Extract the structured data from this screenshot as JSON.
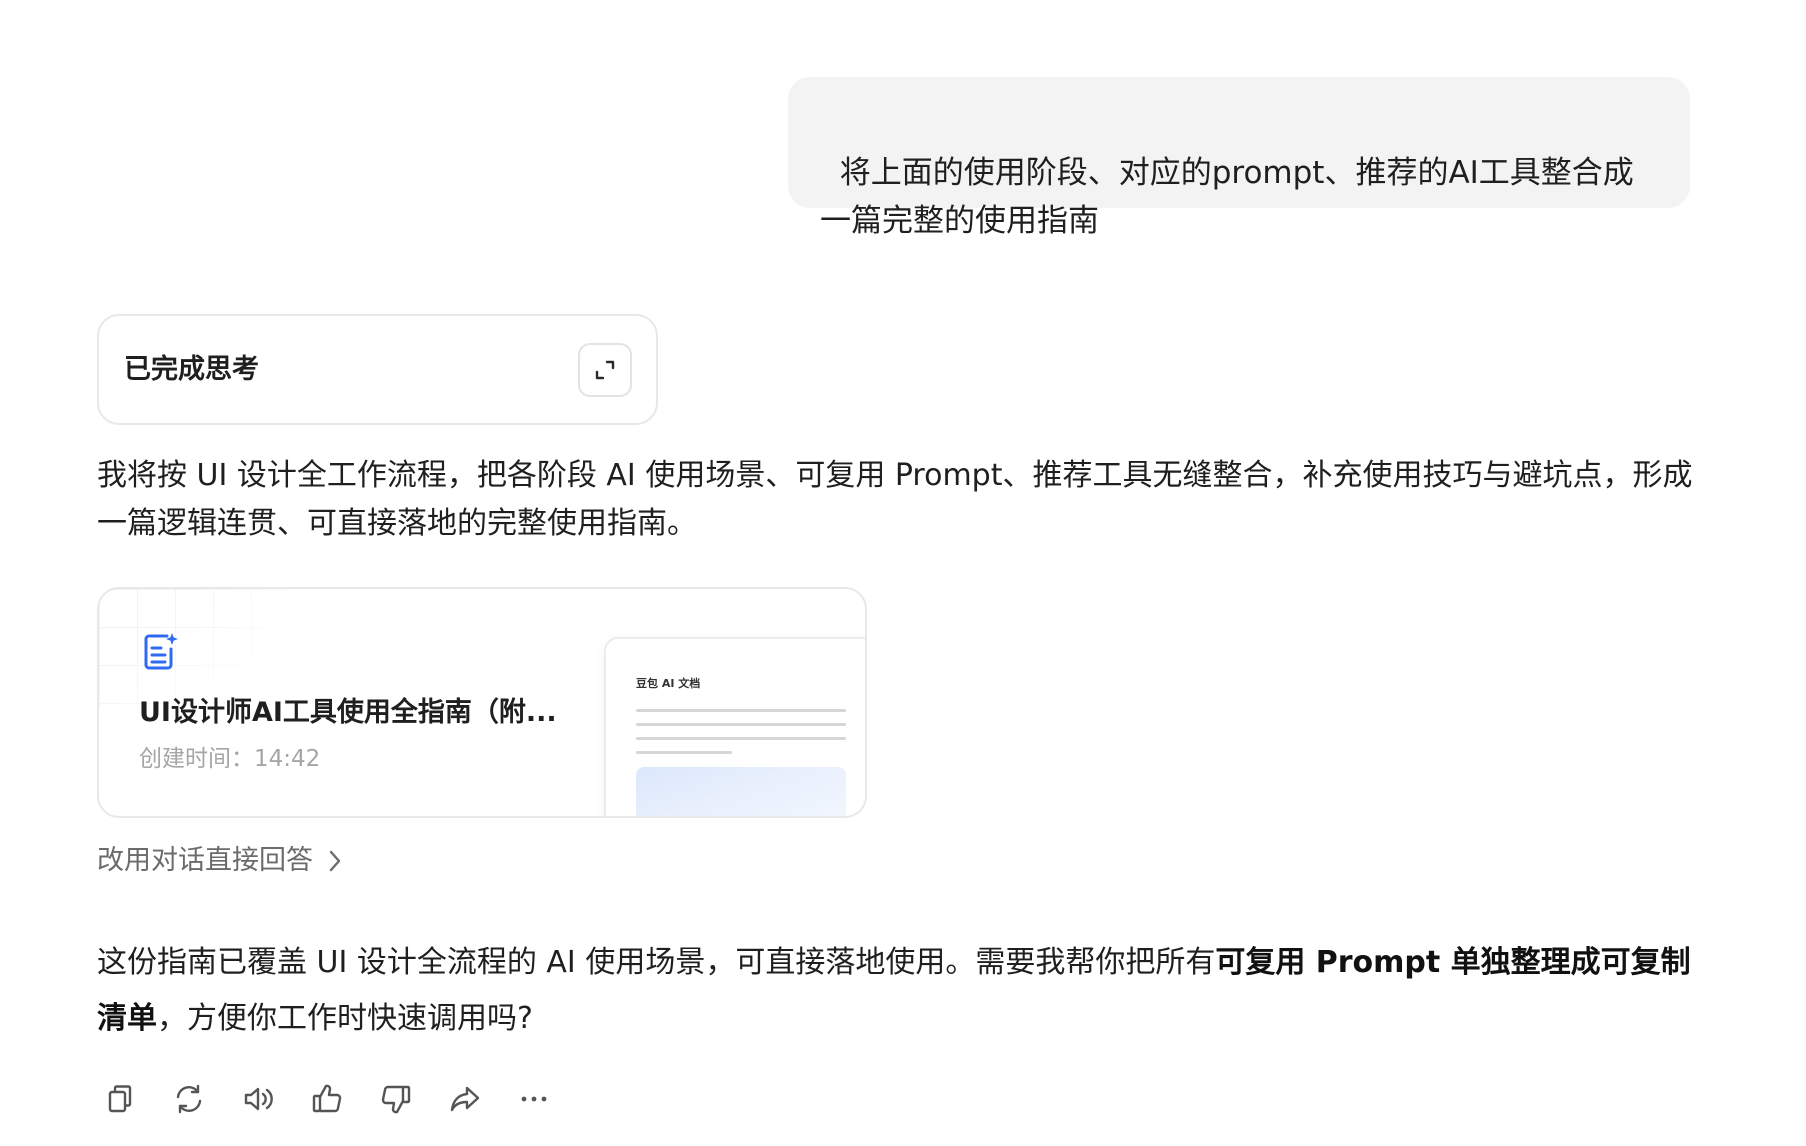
{
  "user_message": {
    "text": "将上面的使用阶段、对应的prompt、推荐的AI工具整合成\n一篇完整的使用指南"
  },
  "thinking": {
    "title": "已完成思考",
    "expand_icon": "expand-icon"
  },
  "reply": {
    "intro": "我将按 UI 设计全工作流程，把各阶段 AI 使用场景、可复用 Prompt、推荐工具无缝整合，补充使用技巧与避坑点，形成一篇逻辑连贯、可直接落地的完整使用指南。",
    "document": {
      "icon": "document-sparkle-icon",
      "title": "UI设计师AI工具使用全指南（附...",
      "created": "创建时间：14:42",
      "preview_title": "豆包 AI 文档"
    },
    "switch_link": "改用对话直接回答",
    "final_before": "这份指南已覆盖 UI 设计全流程的 AI 使用场景，可直接落地使用。需要我帮你把所有",
    "final_bold": "可复用 Prompt 单独整理成可复制清单",
    "final_after": "，方便你工作时快速调用吗?"
  },
  "actions": [
    {
      "name": "copy",
      "icon": "copy-icon"
    },
    {
      "name": "regenerate",
      "icon": "refresh-icon"
    },
    {
      "name": "read-aloud",
      "icon": "speaker-icon"
    },
    {
      "name": "like",
      "icon": "thumbs-up-icon"
    },
    {
      "name": "dislike",
      "icon": "thumbs-down-icon"
    },
    {
      "name": "share",
      "icon": "share-icon"
    },
    {
      "name": "more",
      "icon": "more-icon"
    }
  ],
  "colors": {
    "accent_blue": "#2f6bf2",
    "bubble_bg": "#f3f3f3",
    "muted_text": "#a6a6a6",
    "icon_gray": "#555555"
  }
}
